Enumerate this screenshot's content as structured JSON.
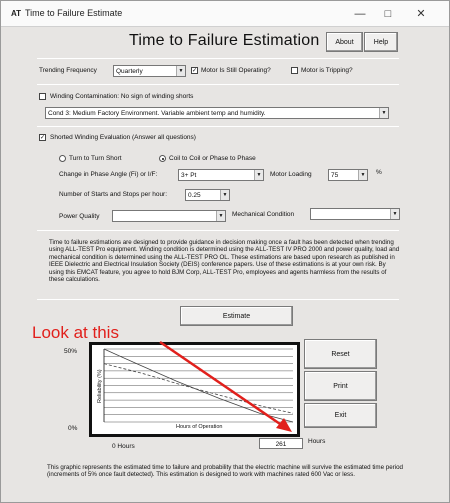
{
  "window": {
    "title": "Time to Failure Estimate",
    "app_icon": "AT",
    "minimize_icon": "minimize-icon",
    "maximize_icon": "maximize-icon",
    "close_icon": "close-icon"
  },
  "header": {
    "title": "Time to Failure Estimation",
    "about_label": "About",
    "help_label": "Help"
  },
  "trending": {
    "label": "Trending Frequency",
    "value": "Quarterly",
    "motor_operating_label": "Motor Is Still Operating?",
    "motor_operating_checked": true,
    "motor_tripping_label": "Motor is Tripping?",
    "motor_tripping_checked": false
  },
  "winding_contamination": {
    "label": "Winding Contamination: No sign of winding shorts",
    "checked": false,
    "condition_value": "Cond 3: Medium Factory Environment. Variable ambient temp and humidity."
  },
  "shorted_winding": {
    "label": "Shorted Winding Evaluation (Answer all questions)",
    "checked": true,
    "radio_turn_label": "Turn to Turn Short",
    "radio_coil_label": "Coil to Coil or Phase to Phase",
    "selected": "coil",
    "phase_angle_label": "Change in Phase Angle (Fi) or I/F:",
    "phase_angle_value": "3+ Pt",
    "motor_loading_label": "Motor Loading",
    "motor_loading_value": "75",
    "motor_loading_unit": "%",
    "starts_label": "Number of Starts and Stops per hour:",
    "starts_value": "0.25",
    "power_quality_label": "Power Quality",
    "power_quality_value": "",
    "mechanical_label": "Mechanical Condition",
    "mechanical_value": ""
  },
  "disclaimer": "Time to failure estimations are designed to provide guidance in decision making once a fault has been detected when trending using ALL-TEST Pro equipment. Winding condition is determined using the ALL-TEST IV PRO 2000 and power quality, load and mechanical condition is determined using the ALL-TEST PRO OL. These estimations are based upon research as published in IEEE Dielectric and Electrical Insulation Society (DEIS) conference papers. Use of these estimations is at your own risk. By using this EMCAT feature, you agree to hold BJM Corp, ALL-TEST Pro, employees and agents harmless from the results of these calculations.",
  "actions": {
    "estimate_label": "Estimate",
    "reset_label": "Reset",
    "print_label": "Print",
    "exit_label": "Exit"
  },
  "chart_data": {
    "type": "line",
    "title": "",
    "xlabel": "Hours of Operation",
    "ylabel": "Reliability (%)",
    "y_top_label": "50%",
    "y_bottom_label": "0%",
    "x_start_label": "0 Hours",
    "x_end_value": "261",
    "x_end_unit": "Hours",
    "xlim": [
      0,
      261
    ],
    "ylim": [
      0,
      50
    ],
    "grid": true,
    "series": [
      {
        "style": "solid",
        "x": [
          0,
          45,
          100,
          160,
          215,
          261
        ],
        "y": [
          50,
          40,
          28,
          16,
          6,
          0
        ]
      },
      {
        "style": "dashed",
        "x": [
          0,
          55,
          110,
          170,
          225,
          261
        ],
        "y": [
          40,
          33,
          25,
          17,
          10,
          6
        ]
      }
    ]
  },
  "footer": "This graphic represents the estimated time to failure and probability that the electric machine will survive the estimated time period (increments of 5% once fault detected). This estimation is designed to work with machines rated 600 Vac or less.",
  "annotation": {
    "text": "Look at this",
    "color": "#e1201c"
  }
}
